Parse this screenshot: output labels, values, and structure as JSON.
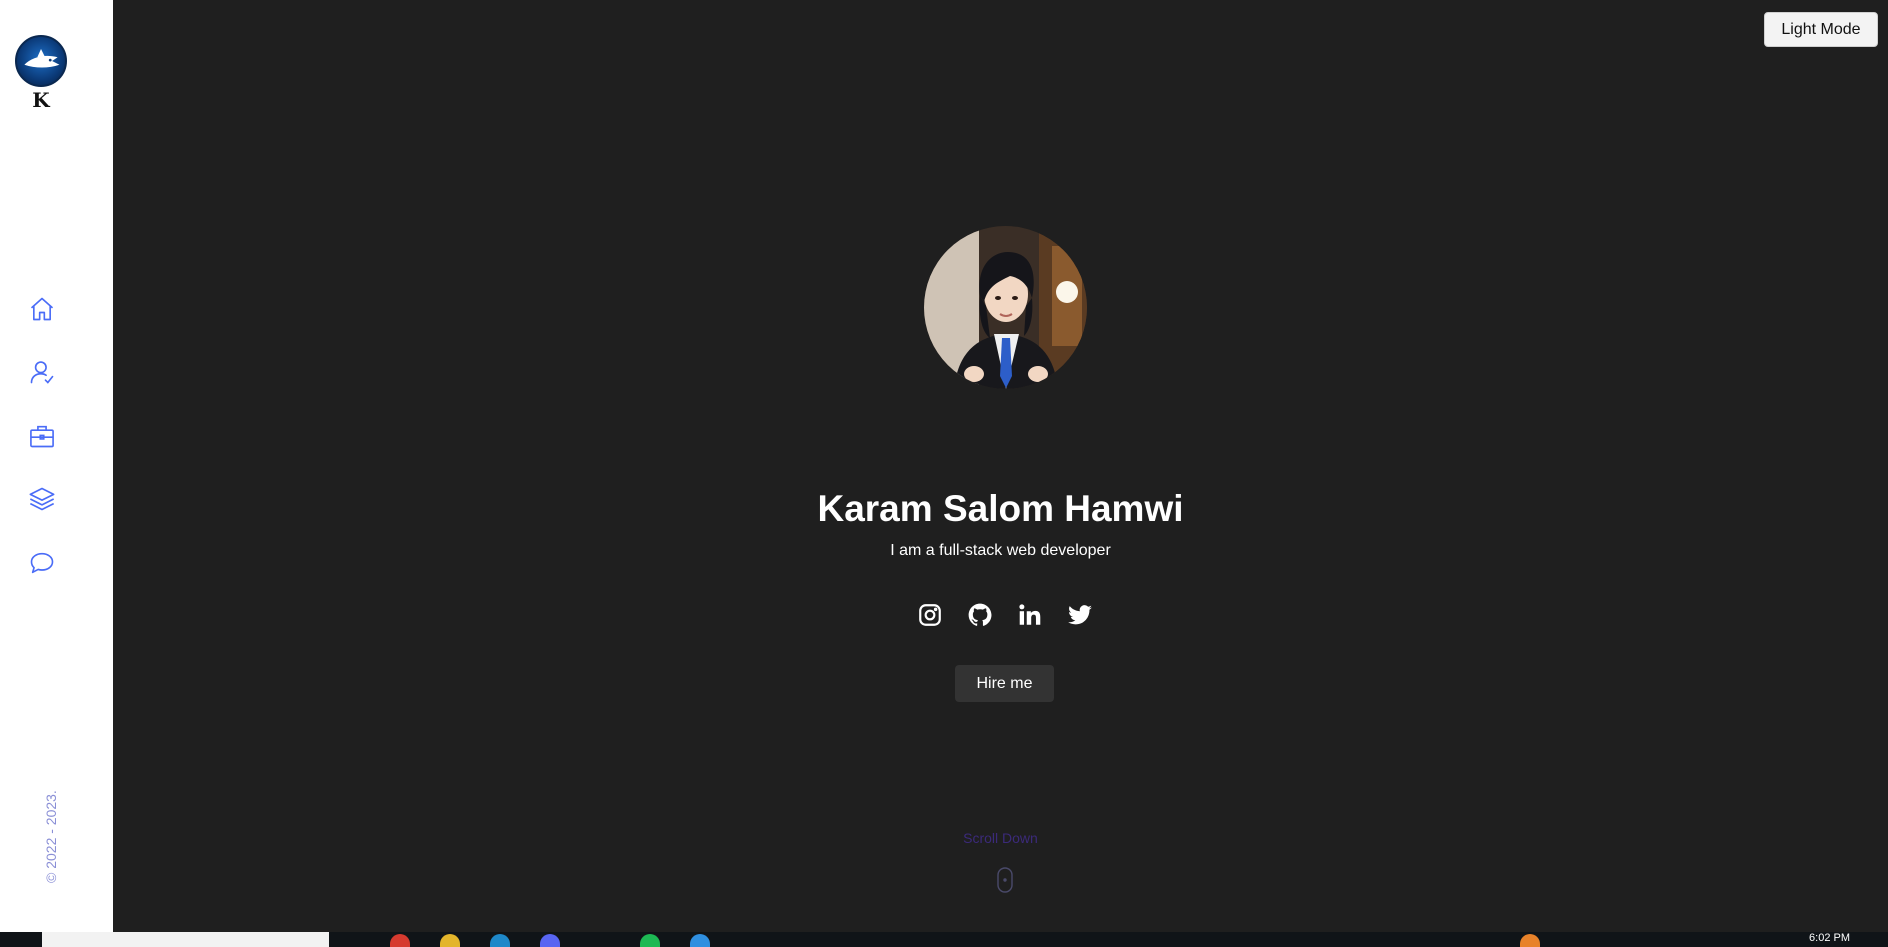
{
  "sidebar": {
    "logo_letter": "K",
    "nav": [
      {
        "name": "home",
        "icon": "home-icon"
      },
      {
        "name": "about",
        "icon": "user-icon"
      },
      {
        "name": "portfolio",
        "icon": "briefcase-icon"
      },
      {
        "name": "services",
        "icon": "layers-icon"
      },
      {
        "name": "contact",
        "icon": "message-icon"
      }
    ],
    "copyright": "© 2022 - 2023."
  },
  "header": {
    "theme_toggle_label": "Light Mode"
  },
  "hero": {
    "name": "Karam Salom Hamwi",
    "subtitle": "I am a full-stack web developer",
    "socials": [
      "instagram-icon",
      "github-icon",
      "linkedin-icon",
      "twitter-icon"
    ],
    "hire_label": "Hire me",
    "scroll_label": "Scroll Down"
  },
  "taskbar": {
    "time": "6:02 PM"
  },
  "colors": {
    "accent": "#4a6cf7",
    "background": "#1f1f1f",
    "sidebar": "#ffffff"
  }
}
